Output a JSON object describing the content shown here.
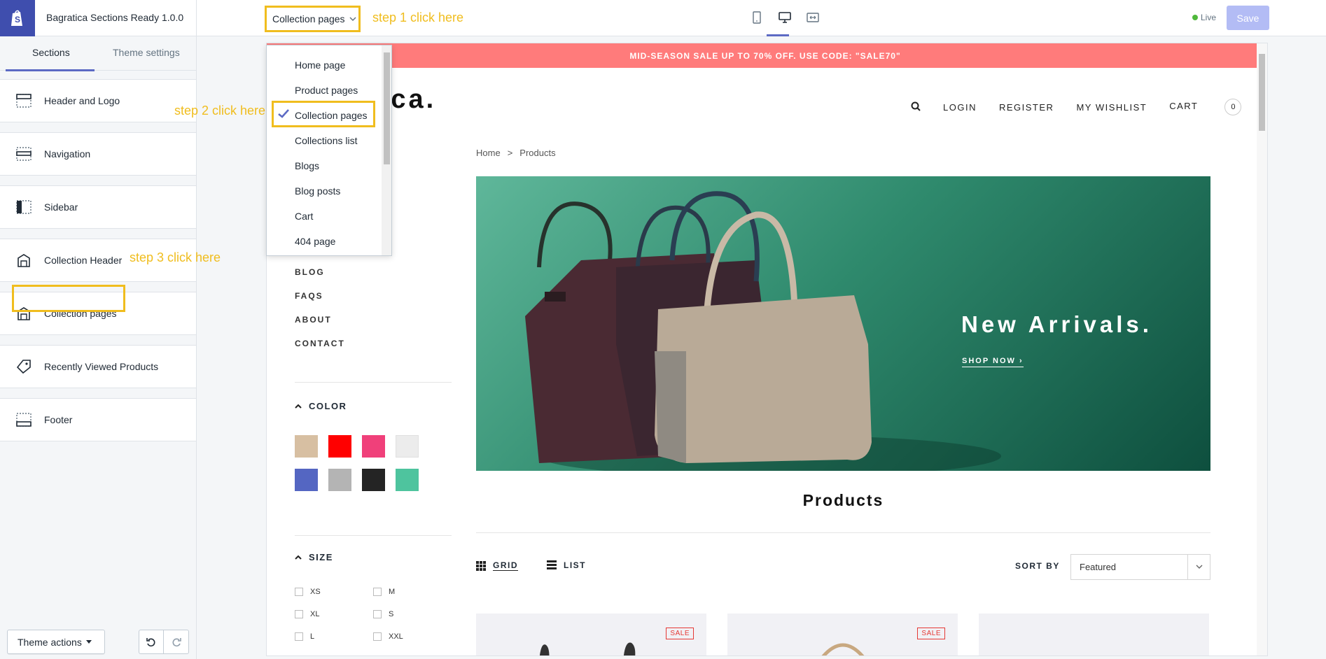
{
  "topbar": {
    "theme_name": "Bagratica Sections Ready 1.0.0",
    "page_select_label": "Collection pages",
    "live_label": "Live",
    "save_label": "Save"
  },
  "annotations": {
    "step1": "step 1 click here",
    "step2": "step 2 click here",
    "step3": "step 3 click here"
  },
  "sidebar": {
    "tabs": [
      "Sections",
      "Theme settings"
    ],
    "items": [
      {
        "label": "Header and Logo",
        "icon": "header-icon"
      },
      {
        "label": "Navigation",
        "icon": "navigation-icon"
      },
      {
        "label": "Sidebar",
        "icon": "sidebar-icon"
      },
      {
        "label": "Collection Header",
        "icon": "collection-icon"
      },
      {
        "label": "Collection pages",
        "icon": "collection-icon"
      },
      {
        "label": "Recently Viewed Products",
        "icon": "tag-icon"
      },
      {
        "label": "Footer",
        "icon": "footer-icon"
      }
    ],
    "theme_actions_label": "Theme actions"
  },
  "dropdown": {
    "options": [
      "Home page",
      "Product pages",
      "Collection pages",
      "Collections list",
      "Blogs",
      "Blog posts",
      "Cart",
      "404 page"
    ],
    "selected": "Collection pages"
  },
  "preview": {
    "promo": "MID-SEASON SALE UP TO 70% OFF. USE CODE: \"SALE70\"",
    "brand": "gratica.",
    "nav": {
      "login": "LOGIN",
      "register": "REGISTER",
      "wishlist": "MY WISHLIST",
      "cart": "CART",
      "cart_count": "0"
    },
    "breadcrumb": {
      "home": "Home",
      "sep": ">",
      "current": "Products"
    },
    "hero": {
      "title": "New Arrivals.",
      "cta": "SHOP NOW"
    },
    "menu_links": [
      "BLOG",
      "FAQS",
      "ABOUT",
      "CONTACT"
    ],
    "color_filter": {
      "title": "COLOR",
      "swatches": [
        "#d7bfa2",
        "#ff0000",
        "#f0407a",
        "#ececec",
        "#5466c2",
        "#b4b4b4",
        "#242424",
        "#4ec49e"
      ]
    },
    "size_filter": {
      "title": "SIZE",
      "sizes": [
        "XS",
        "M",
        "XL",
        "S",
        "L",
        "XXL"
      ]
    },
    "products_title": "Products",
    "grid_label": "GRID",
    "list_label": "LIST",
    "sort_label": "SORT BY",
    "sort_value": "Featured",
    "sale_badge": "SALE"
  },
  "colors": {
    "accent": "#5c6ac4",
    "highlight": "#f0bd1e",
    "promo": "#ff7b7b",
    "live": "#50b83c"
  }
}
